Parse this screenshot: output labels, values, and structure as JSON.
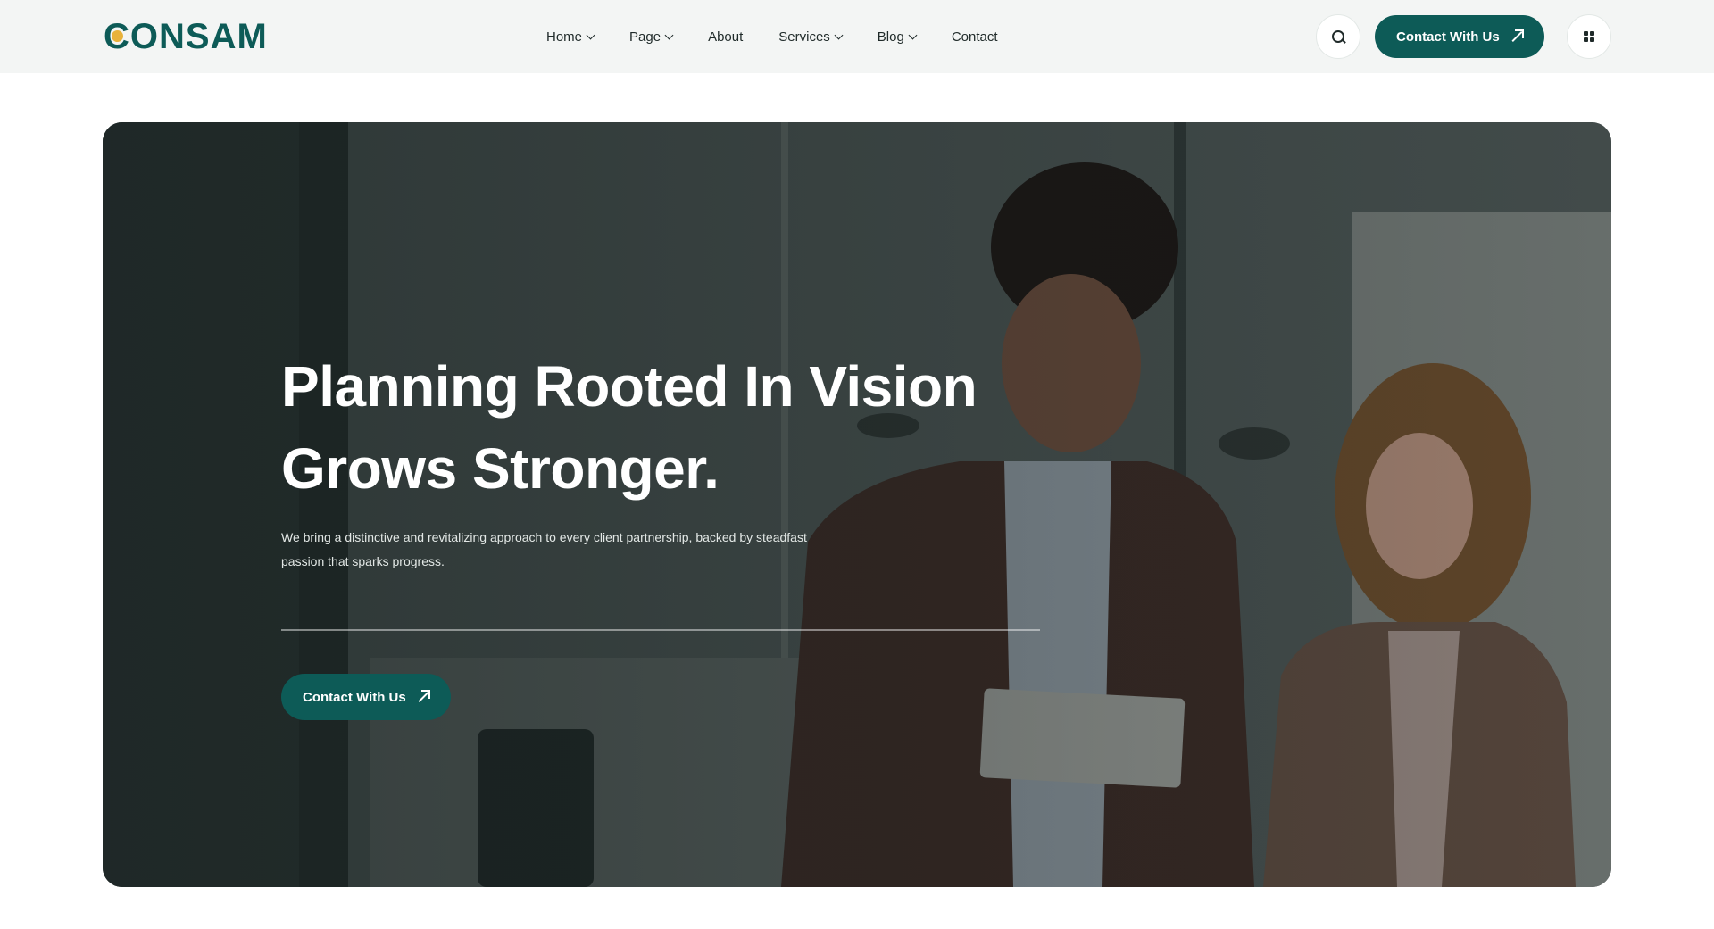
{
  "header": {
    "logo_text": "CONSAM",
    "nav": [
      {
        "label": "Home",
        "has_dropdown": true
      },
      {
        "label": "Page",
        "has_dropdown": true
      },
      {
        "label": "About",
        "has_dropdown": false
      },
      {
        "label": "Services",
        "has_dropdown": true
      },
      {
        "label": "Blog",
        "has_dropdown": true
      },
      {
        "label": "Contact",
        "has_dropdown": false
      }
    ],
    "search_icon": "search-icon",
    "cta_label": "Contact With Us",
    "menu_icon": "grid-menu-icon"
  },
  "hero": {
    "title_line1": "Planning Rooted In Vision",
    "title_line2": "Grows Stronger.",
    "text": "We bring a distinctive and revitalizing approach to every client partnership, backed by steadfast passion that sparks progress.",
    "cta_label": "Contact With Us",
    "image_subject": "two business people looking at a tablet in an office"
  },
  "colors": {
    "brand": "#0d5b57",
    "accent": "#e8b23b",
    "header_bg": "#f3f5f4"
  }
}
